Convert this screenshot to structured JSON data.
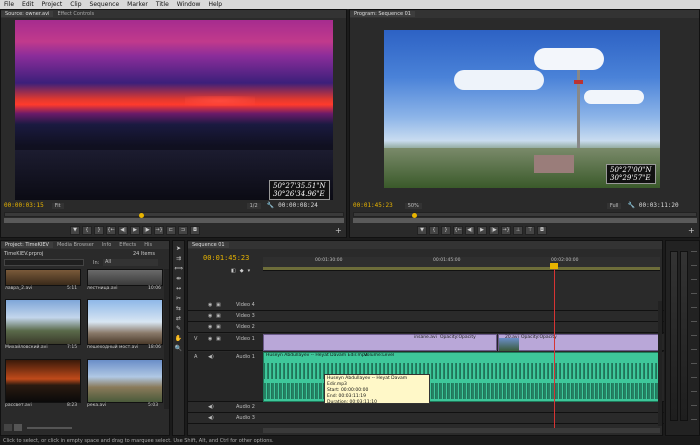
{
  "menu": [
    "File",
    "Edit",
    "Project",
    "Clip",
    "Sequence",
    "Marker",
    "Title",
    "Window",
    "Help"
  ],
  "source": {
    "tabs": [
      "Source: owner.avi",
      "Effect Controls"
    ],
    "timecode_left": "00:00:03:15",
    "fit": "Fit",
    "ratio": "1/2",
    "timecode_right": "00:00:08:24",
    "gps_line1": "50°27'35.51\"N",
    "gps_line2": "30°26'34.96\"E"
  },
  "program": {
    "tabs": [
      "Program: Sequence 01"
    ],
    "timecode_left": "00:01:45:23",
    "zoom": "50%",
    "quality": "Full",
    "timecode_right": "00:03:11:20",
    "gps_line1": "50°27'00\"N",
    "gps_line2": "30°29'57\"E"
  },
  "project": {
    "tabs": [
      "Project: TimeKIEV",
      "Media Browser",
      "Info",
      "Effects",
      "His"
    ],
    "filename": "TimeKIEV.prproj",
    "items_count": "24 Items",
    "in_label": "In:",
    "in_value": "All",
    "items": [
      {
        "name": "лавра_2.avi",
        "dur": "5:11"
      },
      {
        "name": "лестница.avi",
        "dur": "10:06"
      },
      {
        "name": "Михайловский.avi",
        "dur": "7:15"
      },
      {
        "name": "пешеходный мост.avi",
        "dur": "18:06"
      },
      {
        "name": "рассвет.avi",
        "dur": "8:23"
      },
      {
        "name": "река.avi",
        "dur": "5:03"
      }
    ]
  },
  "sequence": {
    "tab": "Sequence 01",
    "timecode": "00:01:45:23",
    "ruler": [
      "00:01:30:00",
      "00:01:45:00",
      "00:02:00:00"
    ],
    "tracks": [
      "Video 4",
      "Video 3",
      "Video 2",
      "Video 1",
      "Audio 1",
      "Audio 2",
      "Audio 3"
    ],
    "clip1": "insane.avi",
    "clip1_fx": "Opacity:Opacity",
    "clip2": "20.avi",
    "clip2_fx": "Opacity:Opacity",
    "audio_clip": "Huseyn Abdullayev -- Heyat Davam Edir.mp3",
    "audio_fx": "Volume:Level",
    "tooltip": {
      "title": "Huseyn Abdullayev -- Heyat Davam Edir.mp3",
      "start": "Start: 00:00:00:00",
      "end": "End: 00:03:11:19",
      "duration": "Duration: 00:03:11:10"
    }
  },
  "status": "Click to select, or click in empty space and drag to marquee select. Use Shift, Alt, and Ctrl for other options.",
  "colors": {
    "accent": "#e8b400",
    "video_clip": "#b9a7d8",
    "audio_clip": "#3ec79a",
    "playhead": "#d63434"
  }
}
